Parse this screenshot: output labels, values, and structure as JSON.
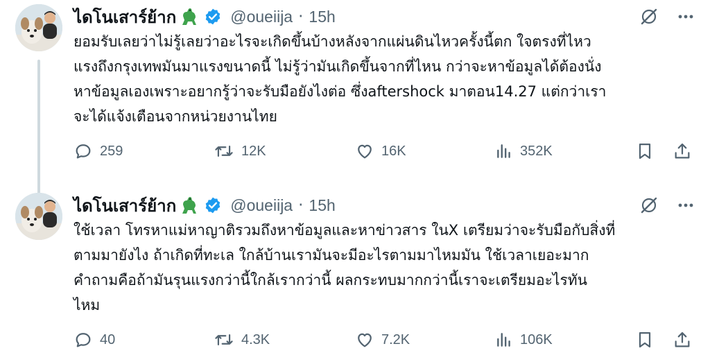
{
  "tweets": [
    {
      "display_name": "ไดโนเสาร์ย้าก",
      "handle": "@oueiija",
      "separator": "·",
      "time": "15h",
      "text": "ยอมรับเลยว่าไม่รู้เลยว่าอะไรจะเกิดขึ้นบ้างหลังจากแผ่นดินไหวครั้งนี้ตก ใจตรงที่ไหว\nแรงถึงกรุงเทพมันมาแรงขนาดนี้ ไม่รู้ว่ามันเกิดขึ้นจากที่ไหน กว่าจะหาข้อมูลได้ต้องนั่ง\nหาข้อมูลเองเพราะอยากรู้ว่าจะรับมือยังไงต่อ  ซึ่งaftershock มาตอน14.27 แต่กว่าเรา\nจะได้แจ้งเตือนจากหน่วยงานไทย",
      "replies": "259",
      "reposts": "12K",
      "likes": "16K",
      "views": "352K"
    },
    {
      "display_name": "ไดโนเสาร์ย้าก",
      "handle": "@oueiija",
      "separator": "·",
      "time": "15h",
      "text": "ใช้เวลา โทรหาแม่หาญาติรวมถึงหาข้อมูลและหาข่าวสาร ในX เตรียมว่าจะรับมือกับสิ่งที่\nตามมายังไง ถ้าเกิดที่ทะเล ใกล้บ้านเรามันจะมีอะไรตามมาไหมมัน ใช้เวลาเยอะมาก\nคำถามคือถ้ามันรุนแรงกว่านี้ใกล้เรากว่านี้ ผลกระทบมากกว่านี้เราจะเตรียมอะไรทัน\nไหม",
      "replies": "40",
      "reposts": "4.3K",
      "likes": "7.2K",
      "views": "106K"
    }
  ],
  "colors": {
    "text": "#0f1419",
    "muted": "#536471",
    "verified": "#1d9bf0",
    "line": "#cfd9de",
    "dino": "#3fa34d"
  },
  "icons": [
    "dinosaur-emoji",
    "verified-badge-icon",
    "grok-slash-icon",
    "more-icon",
    "reply-icon",
    "repost-icon",
    "like-icon",
    "views-icon",
    "bookmark-icon",
    "share-icon"
  ]
}
